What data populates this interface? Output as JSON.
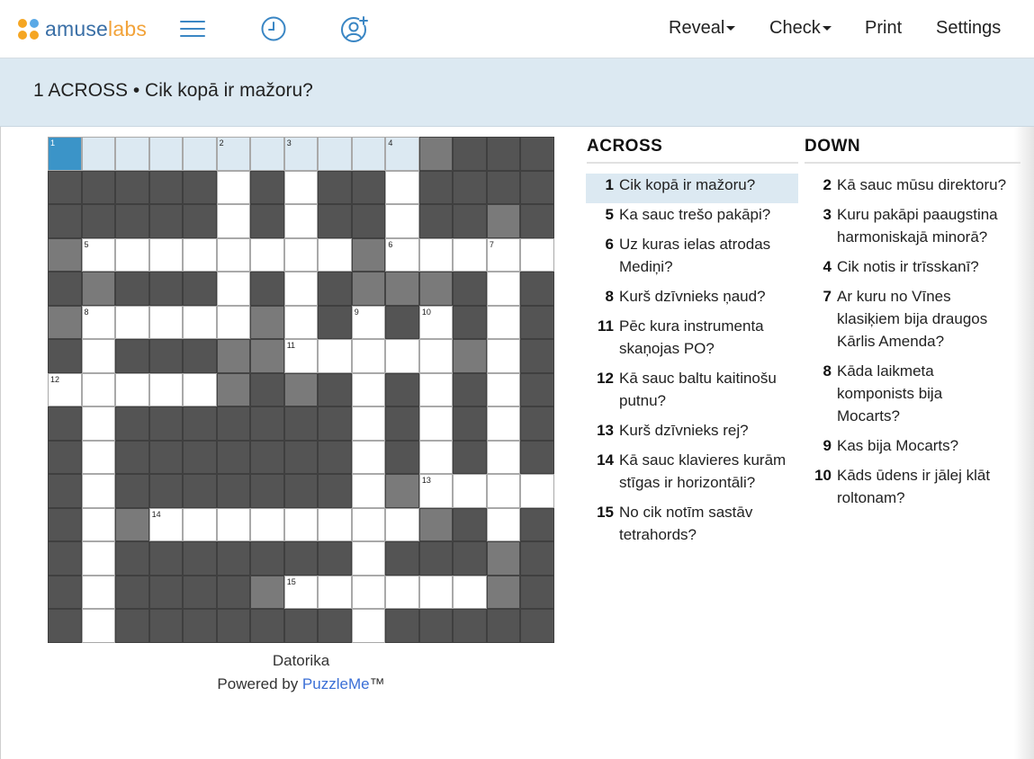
{
  "brand": {
    "name_part1": "amuse",
    "name_part2": "labs"
  },
  "header_icons": [
    "menu-icon",
    "clock-icon",
    "add-user-icon"
  ],
  "menu": {
    "reveal": "Reveal",
    "check": "Check",
    "print": "Print",
    "settings": "Settings"
  },
  "current_clue": "1 ACROSS • Cik kopā ir mažoru?",
  "colors": {
    "selected_cell": "#3b94c8",
    "highlight": "#dce9f2",
    "block": "#545454",
    "shaded": "#7a7a7a",
    "link": "#3b6fd6"
  },
  "grid": {
    "size": 15,
    "rows": [
      "SHHHHHHHHHHGBBB",
      "BBBBBWBWBBWBBBB",
      "BBBBBWBWBBWBBGB",
      "GWWWWWWWWGWWWWW",
      "BGBBBWBWBGGGBWB",
      "GWWWWWGWBWBWBWB",
      "BWBBBGGWWWWWGWB",
      "WWWWWGBGBWBWBWB",
      "BWBBBBBBBWBWBWB",
      "BWBBBBBBBWBWBWB",
      "BWBBBBBBBWGWWWW",
      "BWGWWWWWWWWGBWB",
      "BWBBBBBBBWBBBGB",
      "BWBBBBGWWWWWWGB",
      "BWBBBBBBBWBBBBB"
    ],
    "numbers": [
      {
        "r": 0,
        "c": 0,
        "n": "1"
      },
      {
        "r": 0,
        "c": 5,
        "n": "2"
      },
      {
        "r": 0,
        "c": 7,
        "n": "3"
      },
      {
        "r": 0,
        "c": 10,
        "n": "4"
      },
      {
        "r": 3,
        "c": 1,
        "n": "5"
      },
      {
        "r": 3,
        "c": 10,
        "n": "6"
      },
      {
        "r": 3,
        "c": 13,
        "n": "7"
      },
      {
        "r": 5,
        "c": 1,
        "n": "8"
      },
      {
        "r": 5,
        "c": 9,
        "n": "9"
      },
      {
        "r": 5,
        "c": 11,
        "n": "10"
      },
      {
        "r": 6,
        "c": 7,
        "n": "11"
      },
      {
        "r": 7,
        "c": 0,
        "n": "12"
      },
      {
        "r": 10,
        "c": 11,
        "n": "13"
      },
      {
        "r": 11,
        "c": 3,
        "n": "14"
      },
      {
        "r": 13,
        "c": 7,
        "n": "15"
      }
    ]
  },
  "puzzle_title": "Datorika",
  "powered": {
    "prefix": "Powered by ",
    "link": "PuzzleMe",
    "suffix": "™"
  },
  "across": {
    "heading": "ACROSS",
    "clues": [
      {
        "num": "1",
        "text": "Cik kopā ir mažoru?",
        "active": true
      },
      {
        "num": "5",
        "text": "Ka sauc trešo pakāpi?"
      },
      {
        "num": "6",
        "text": "Uz kuras ielas atrodas Mediņi?"
      },
      {
        "num": "8",
        "text": "Kurš dzīvnieks ņaud?"
      },
      {
        "num": "11",
        "text": "Pēc kura instrumenta skaņojas PO?"
      },
      {
        "num": "12",
        "text": "Kā sauc baltu kaitinošu putnu?"
      },
      {
        "num": "13",
        "text": "Kurš dzīvnieks rej?"
      },
      {
        "num": "14",
        "text": "Kā sauc klavieres kurām stīgas ir horizontāli?"
      },
      {
        "num": "15",
        "text": "No cik notīm sastāv tetrahords?"
      }
    ]
  },
  "down": {
    "heading": "DOWN",
    "clues": [
      {
        "num": "2",
        "text": "Kā sauc mūsu direktoru?"
      },
      {
        "num": "3",
        "text": "Kuru pakāpi paaugstina harmoniskajā minorā?"
      },
      {
        "num": "4",
        "text": "Cik notis ir trīsskanī?"
      },
      {
        "num": "7",
        "text": "Ar kuru no Vīnes klasiķiem bija draugos Kārlis Amenda?"
      },
      {
        "num": "8",
        "text": "Kāda laikmeta komponists bija Mocarts?"
      },
      {
        "num": "9",
        "text": "Kas bija Mocarts?"
      },
      {
        "num": "10",
        "text": "Kāds ūdens ir jālej klāt roltonam?"
      }
    ]
  }
}
